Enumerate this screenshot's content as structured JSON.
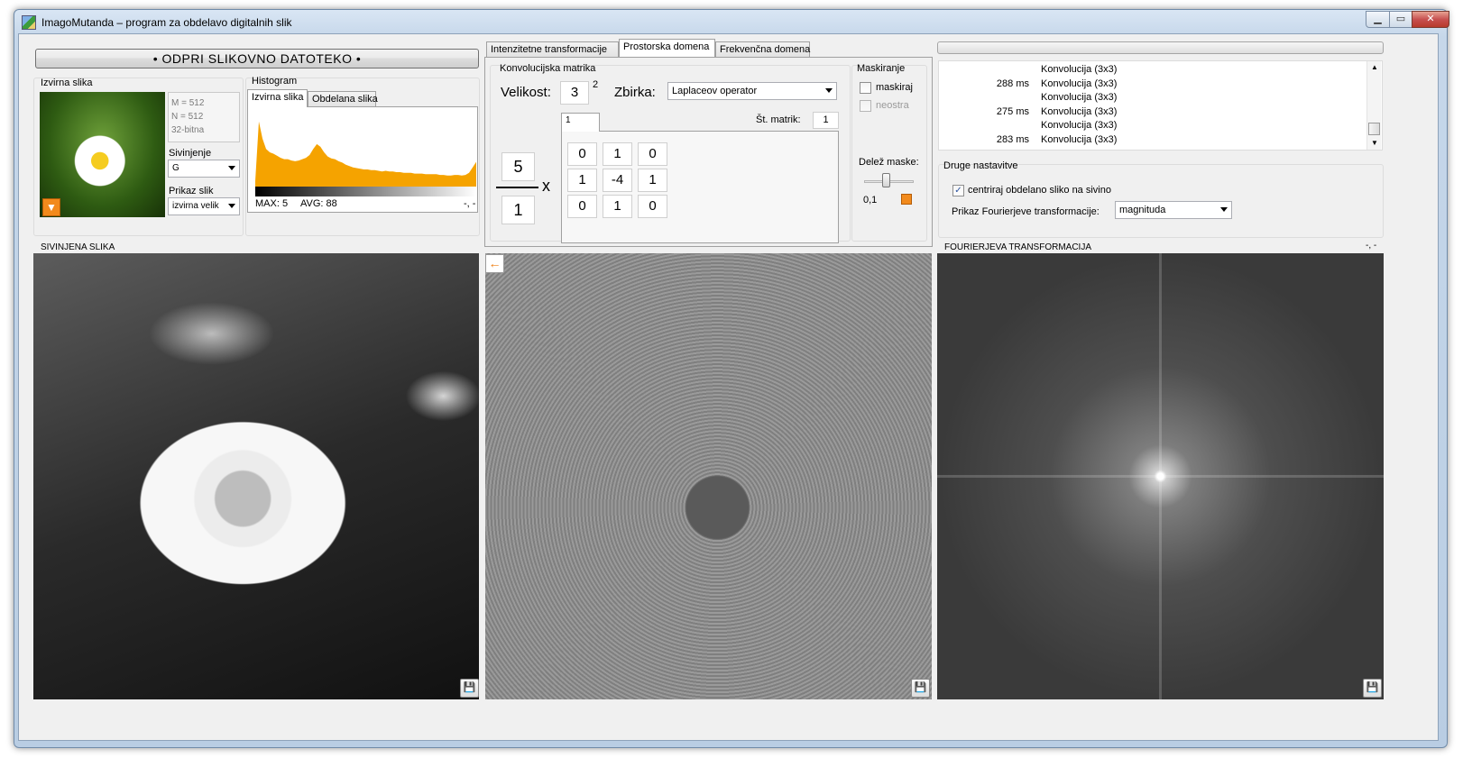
{
  "window": {
    "title": "ImagoMutanda – program za obdelavo digitalnih slik",
    "minimize": "▁",
    "maximize": "▭",
    "close": "✕"
  },
  "source": {
    "open_button": "• ODPRI SLIKOVNO DATOTEKO •",
    "title": "Izvirna slika",
    "info_m": "M = 512",
    "info_n": "N = 512",
    "info_bits": "32-bitna",
    "gray_label": "Sivinjenje",
    "gray_value": "G",
    "view_label": "Prikaz slik",
    "view_value": "izvirna velik"
  },
  "histogram": {
    "title": "Histogram",
    "tabs": [
      "Izvirna slika",
      "Obdelana slika"
    ],
    "active_tab": 0,
    "max": "MAX: 5",
    "avg": "AVG: 88",
    "corner": "-, -",
    "fill_color": "#f5a300",
    "profile": [
      0.08,
      0.95,
      0.7,
      0.55,
      0.5,
      0.48,
      0.45,
      0.42,
      0.4,
      0.4,
      0.38,
      0.37,
      0.38,
      0.4,
      0.42,
      0.46,
      0.55,
      0.62,
      0.58,
      0.5,
      0.44,
      0.41,
      0.4,
      0.37,
      0.35,
      0.32,
      0.3,
      0.28,
      0.27,
      0.26,
      0.25,
      0.25,
      0.24,
      0.24,
      0.23,
      0.22,
      0.23,
      0.22,
      0.22,
      0.21,
      0.21,
      0.2,
      0.2,
      0.2,
      0.19,
      0.19,
      0.19,
      0.18,
      0.18,
      0.18,
      0.18,
      0.17,
      0.17,
      0.16,
      0.16,
      0.17,
      0.17,
      0.16,
      0.17,
      0.2,
      0.28,
      0.36
    ]
  },
  "tabs": [
    "Intenzitetne transformacije",
    "Prostorska domena",
    "Frekvenčna domena"
  ],
  "active_tab": 1,
  "convolution": {
    "title": "Konvolucijska matrika",
    "size_label": "Velikost:",
    "size_value": "3",
    "size_exp": "2",
    "set_label": "Zbirka:",
    "set_value": "Laplaceov operator",
    "sub_tab": "1",
    "count_label": "Št. matrik:",
    "count_value": "1",
    "numerator": "5",
    "denominator": "1",
    "times": "x",
    "matrix": [
      [
        "0",
        "1",
        "0"
      ],
      [
        "1",
        "-4",
        "1"
      ],
      [
        "0",
        "1",
        "0"
      ]
    ]
  },
  "masking": {
    "title": "Maskiranje",
    "mask_label": "maskiraj",
    "mask_checked": false,
    "blur_label": "neostra",
    "blur_checked": false,
    "share_label": "Delež maske:",
    "share_value": "0,1",
    "share_fraction": 0.4
  },
  "log": [
    {
      "time": "",
      "text": "Konvolucija (3x3)"
    },
    {
      "time": "288 ms",
      "text": "Konvolucija (3x3)"
    },
    {
      "time": "",
      "text": "Konvolucija (3x3)"
    },
    {
      "time": "275 ms",
      "text": "Konvolucija (3x3)"
    },
    {
      "time": "",
      "text": "Konvolucija (3x3)"
    },
    {
      "time": "283 ms",
      "text": "Konvolucija (3x3)"
    }
  ],
  "other": {
    "title": "Druge nastavitve",
    "center_label": "centriraj obdelano sliko na sivino",
    "center_checked": true,
    "fourier_label": "Prikaz Fourierjeve transformacije:",
    "fourier_value": "magnituda"
  },
  "panels": {
    "gray_title": "SIVINJENA SLIKA",
    "fourier_title": "FOURIERJEVA TRANSFORMACIJA",
    "fourier_corner": "-, -",
    "save_icon": "💾",
    "back_icon": "←",
    "arrow_icon": "▼"
  }
}
